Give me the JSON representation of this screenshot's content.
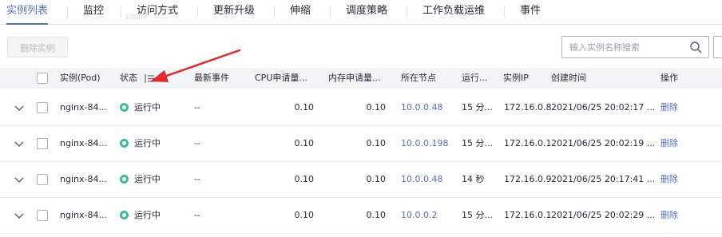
{
  "tabs": [
    {
      "label": "实例列表"
    },
    {
      "label": "监控"
    },
    {
      "label": "访问方式"
    },
    {
      "label": "更新升级"
    },
    {
      "label": "伸缩"
    },
    {
      "label": "调度策略"
    },
    {
      "label": "工作负载运维"
    },
    {
      "label": "事件"
    }
  ],
  "active_tab": "实例列表",
  "watermark_text": "10007",
  "toolbar": {
    "delete_button_label": "删除实例",
    "search_placeholder": "输入实例名称搜索"
  },
  "table": {
    "columns": [
      "实例(Pod)",
      "状态",
      "最新事件",
      "CPU申请量...",
      "内存申请量...",
      "所在节点",
      "运行...",
      "实例IP",
      "创建时间",
      "操作"
    ],
    "rows": [
      {
        "name": "nginx-84...",
        "status": "运行中",
        "event": "--",
        "cpu": "0.10",
        "mem": "0.10",
        "node": "10.0.0.48",
        "runtime": "15 分...",
        "ip": "172.16.0.8",
        "created": "2021/06/25 20:02:17 ...",
        "action": "删除"
      },
      {
        "name": "nginx-84...",
        "status": "运行中",
        "event": "--",
        "cpu": "0.10",
        "mem": "0.10",
        "node": "10.0.0.198",
        "runtime": "15 分...",
        "ip": "172.16.0.1",
        "created": "2021/06/25 20:02:19 ...",
        "action": "删除"
      },
      {
        "name": "nginx-84...",
        "status": "运行中",
        "event": "--",
        "cpu": "0.10",
        "mem": "0.10",
        "node": "10.0.0.48",
        "runtime": "14 秒",
        "ip": "172.16.0.9",
        "created": "2021/06/25 20:17:41 ...",
        "action": "删除"
      },
      {
        "name": "nginx-84...",
        "status": "运行中",
        "event": "--",
        "cpu": "0.10",
        "mem": "0.10",
        "node": "10.0.0.2",
        "runtime": "15 分...",
        "ip": "172.16.0.1",
        "created": "2021/06/25 20:02:29 ...",
        "action": "删除"
      }
    ]
  },
  "colors": {
    "accent": "#526ecc",
    "running": "#3fb9a0",
    "annotation_arrow": "#e8262b"
  }
}
